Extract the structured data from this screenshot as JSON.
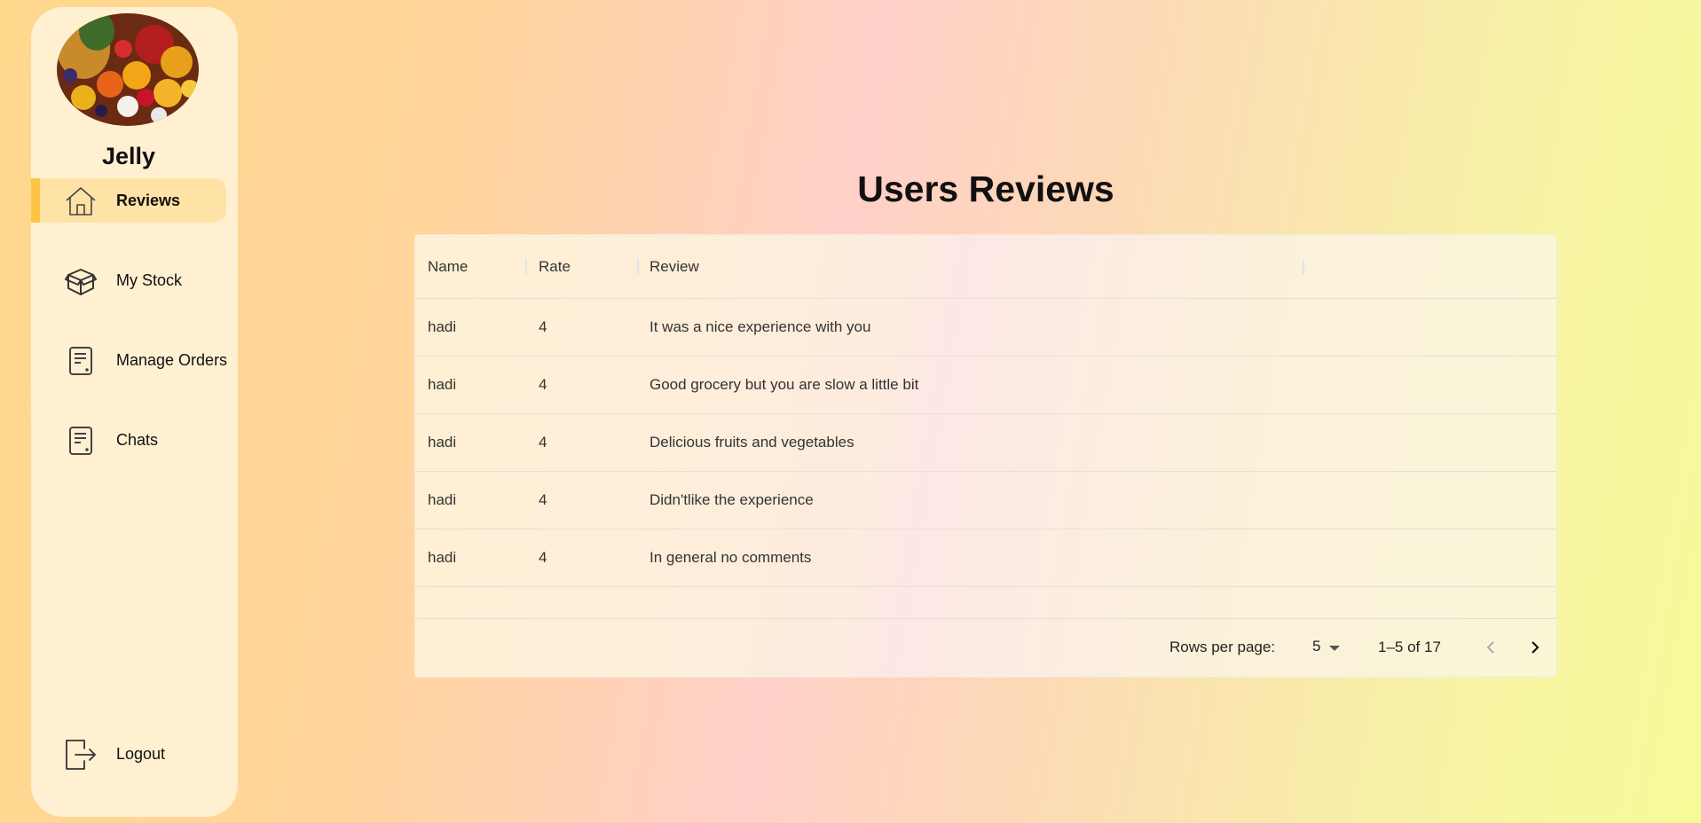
{
  "app": {
    "name": "Jelly"
  },
  "sidebar": {
    "logo_alt": "fruit-basket-logo",
    "items": [
      {
        "label": "Reviews",
        "icon": "home-icon",
        "active": true
      },
      {
        "label": "My Stock",
        "icon": "box-icon",
        "active": false
      },
      {
        "label": "Manage Orders",
        "icon": "document-icon",
        "active": false
      },
      {
        "label": "Chats",
        "icon": "document-icon",
        "active": false
      }
    ],
    "logout": {
      "label": "Logout",
      "icon": "logout-icon"
    }
  },
  "main": {
    "title": "Users Reviews",
    "table": {
      "columns": [
        "Name",
        "Rate",
        "Review"
      ],
      "rows": [
        {
          "name": "hadi",
          "rate": "4",
          "review": "It was a nice experience with you"
        },
        {
          "name": "hadi",
          "rate": "4",
          "review": "Good grocery but you are slow a little bit"
        },
        {
          "name": "hadi",
          "rate": "4",
          "review": "Delicious fruits and vegetables"
        },
        {
          "name": "hadi",
          "rate": "4",
          "review": "Didn'tlike the experience"
        },
        {
          "name": "hadi",
          "rate": "4",
          "review": "In general no comments"
        }
      ]
    },
    "pagination": {
      "rows_per_page_label": "Rows per page:",
      "rows_per_page": "5",
      "range": "1–5 of 17"
    }
  },
  "colors": {
    "sidebar_bg": "#fff0d2",
    "active_bg": "#ffe3a6",
    "active_accent": "#ffc443"
  }
}
